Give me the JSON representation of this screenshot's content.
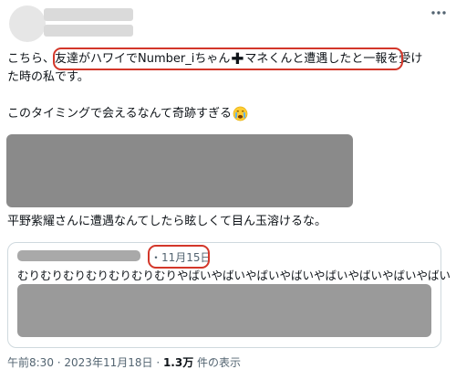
{
  "post": {
    "line1_a": "こちら、",
    "line1_b": "友達がハワイでNumber_iちゃん",
    "line1_c": "マネくんと遭遇したと一報を受け",
    "line2": "た時の私です。",
    "line3_a": "このタイミングで会えるなんて奇跡すぎる",
    "line4": "平野紫耀さんに遭遇なんてしたら眩しくて目ん玉溶けるな。"
  },
  "quote": {
    "date_prefix": "・",
    "date": "11月15日",
    "text": "むりむりむりむりむりむりむりやばいやばいやばいやばいやばいやばいやばいやばい"
  },
  "meta": {
    "time": "午前8:30",
    "separator1": " · ",
    "date": "2023年11月18日",
    "separator2": " · ",
    "views_count": "1.3万",
    "views_label": " 件の表示"
  },
  "icons": {
    "plus": "plus-icon",
    "crying_face": "crying-face-emoji",
    "more": "more-options-icon"
  },
  "colors": {
    "highlight_circle": "#d3372a",
    "secondary_text": "#536471"
  }
}
